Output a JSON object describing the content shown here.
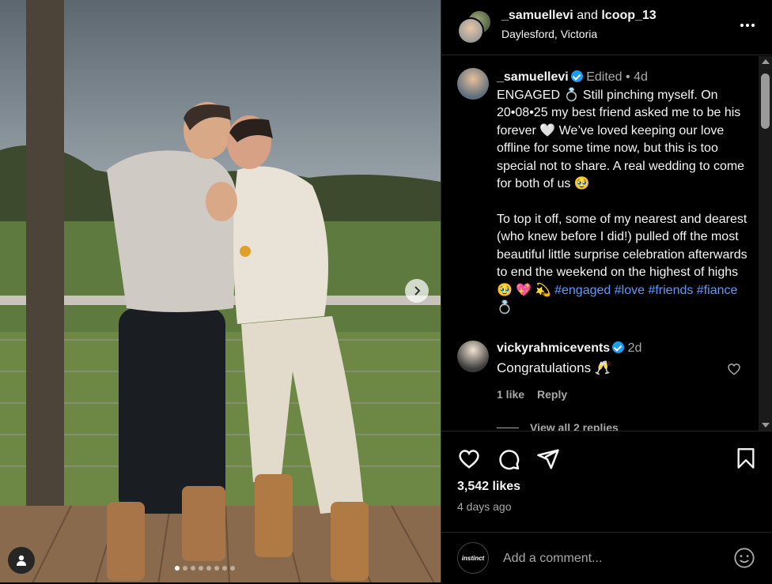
{
  "header": {
    "user1": "_samuellevi",
    "joiner": "and",
    "user2": "lcoop_13",
    "location": "Daylesford, Victoria"
  },
  "caption": {
    "username": "_samuellevi",
    "edited": "Edited",
    "sep": "•",
    "age": "4d",
    "p1": "ENGAGED 💍 Still pinching myself. On 20•08•25 my best friend asked me to be his forever 🤍 We’ve loved keeping our love offline for some time now, but this is too special not to share. A real wedding to come for both of us 🥹",
    "p2": "To top it off, some of my nearest and dearest (who knew before I did!) pulled off the most beautiful little surprise celebration afterwards to end the weekend on the highest of highs 🥹 💖 💫",
    "hashtags": "#engaged #love #friends #fiance💍"
  },
  "comment": {
    "username": "vickyrahmicevents",
    "age": "2d",
    "text": "Congratulations 🥂",
    "likes": "1 like",
    "reply": "Reply",
    "view_replies": "View all 2 replies"
  },
  "stats": {
    "likes": "3,542 likes",
    "ago": "4 days ago"
  },
  "composer": {
    "avatar_label": "instinct",
    "placeholder": "Add a comment..."
  },
  "carousel": {
    "dots": 8,
    "active": 0
  },
  "icons": [
    "heart-icon",
    "comment-icon",
    "share-icon",
    "bookmark-icon",
    "emoji-icon",
    "more-icon",
    "chevron-right-icon",
    "user-tag-icon",
    "verified-icon"
  ],
  "colors": {
    "background": "#000000",
    "text": "#f5f5f5",
    "muted": "#a8a8a8",
    "hashtag": "#5b9bff",
    "verified": "#1d9bf0"
  }
}
